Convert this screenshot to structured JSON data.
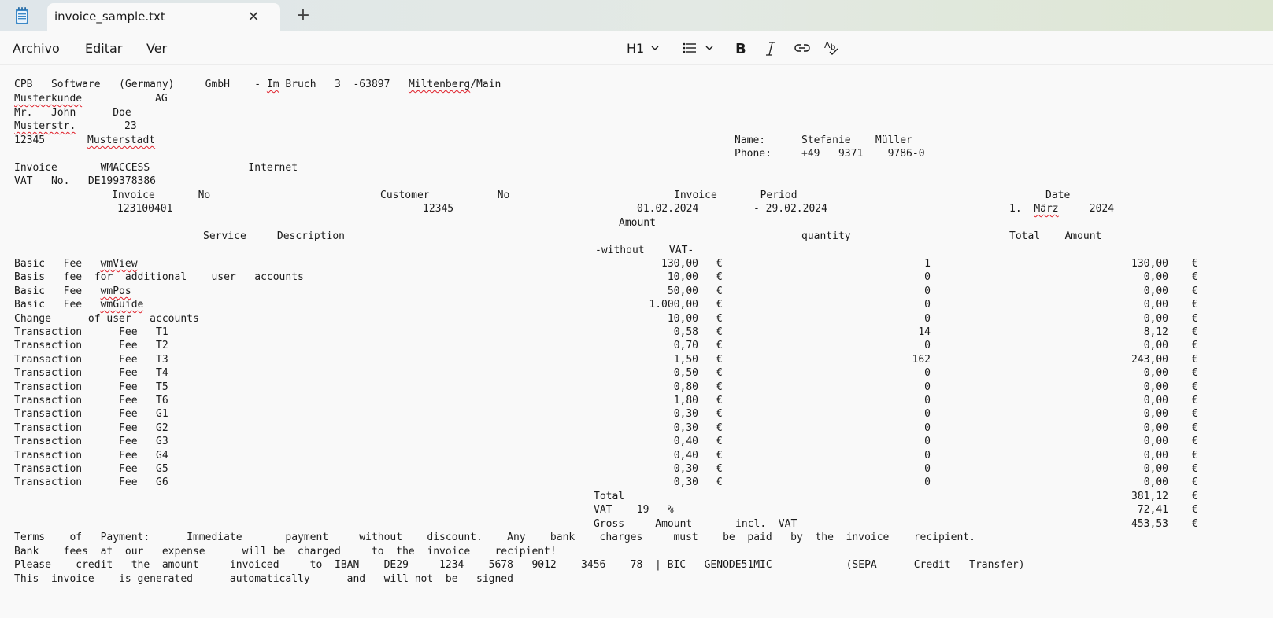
{
  "window": {
    "app_icon": "notepad-icon",
    "tab_title": "invoice_sample.txt",
    "close_icon": "close-icon",
    "new_tab_icon": "plus-icon"
  },
  "menu": {
    "items": [
      "Archivo",
      "Editar",
      "Ver"
    ]
  },
  "toolbar": {
    "heading_label": "H1",
    "heading_icon": "chevron-down-icon",
    "list_icon": "bulleted-list-icon",
    "bold_icon": "bold-icon",
    "italic_icon": "italic-icon",
    "link_icon": "link-icon",
    "spellcheck_icon": "spellcheck-icon"
  },
  "document": {
    "header": {
      "company_a": "CPB   Software   (Germany)     GmbH    - ",
      "company_im": "Im",
      "company_b": " Bruch   3  -63897   ",
      "company_city": "Miltenberg",
      "company_c": "/Main",
      "customer_name": "Musterkunde",
      "customer_ag": "AG",
      "contact": "Mr.   John      Doe",
      "street": "Musterstr.",
      "street_no": "23",
      "zip": "12345",
      "city": "Musterstadt",
      "name_label": "Name:",
      "name_value": "Stefanie    Müller",
      "phone_label": "Phone:",
      "phone_value": "+49   9371    9786-0",
      "invoice_line": "Invoice       WMACCESS                Internet",
      "vat_line": "VAT   No.   DE199378386"
    },
    "invoice_info": {
      "col_invoice_no": "Invoice       No",
      "col_customer_no": "Customer           No",
      "col_period": "Invoice       Period",
      "col_date": "Date",
      "invoice_no": "123100401",
      "customer_no": "12345",
      "period_from": "01.02.2024",
      "period_to": "- 29.02.2024",
      "date_a": "1.  ",
      "date_month": "März",
      "date_b": "     2024"
    },
    "table_header": {
      "amount": "Amount",
      "service": "Service     Description",
      "quantity": "quantity",
      "total_amount": "Total    Amount",
      "without_vat": "-without    VAT-"
    },
    "rows": [
      {
        "desc_a": "Basic   Fee   ",
        "desc_b": "wmView",
        "desc_c": "",
        "amount": "130,00",
        "cur": "€",
        "qty": "1",
        "total": "130,00",
        "cur2": "€"
      },
      {
        "desc_a": "Basis   fee  for  additional    user   accounts",
        "desc_b": "",
        "desc_c": "",
        "amount": "10,00",
        "cur": "€",
        "qty": "0",
        "total": "0,00",
        "cur2": "€"
      },
      {
        "desc_a": "Basic   Fee   ",
        "desc_b": "wmPos",
        "desc_c": "",
        "amount": "50,00",
        "cur": "€",
        "qty": "0",
        "total": "0,00",
        "cur2": "€"
      },
      {
        "desc_a": "Basic   Fee   ",
        "desc_b": "wmGuide",
        "desc_c": "",
        "amount": "1.000,00",
        "cur": "€",
        "qty": "0",
        "total": "0,00",
        "cur2": "€"
      },
      {
        "desc_a": "Change      of user   accounts",
        "desc_b": "",
        "desc_c": "",
        "amount": "10,00",
        "cur": "€",
        "qty": "0",
        "total": "0,00",
        "cur2": "€"
      },
      {
        "desc_a": "Transaction      Fee   T1",
        "desc_b": "",
        "desc_c": "",
        "amount": "0,58",
        "cur": "€",
        "qty": "14",
        "total": "8,12",
        "cur2": "€"
      },
      {
        "desc_a": "Transaction      Fee   T2",
        "desc_b": "",
        "desc_c": "",
        "amount": "0,70",
        "cur": "€",
        "qty": "0",
        "total": "0,00",
        "cur2": "€"
      },
      {
        "desc_a": "Transaction      Fee   T3",
        "desc_b": "",
        "desc_c": "",
        "amount": "1,50",
        "cur": "€",
        "qty": "162",
        "total": "243,00",
        "cur2": "€"
      },
      {
        "desc_a": "Transaction      Fee   T4",
        "desc_b": "",
        "desc_c": "",
        "amount": "0,50",
        "cur": "€",
        "qty": "0",
        "total": "0,00",
        "cur2": "€"
      },
      {
        "desc_a": "Transaction      Fee   T5",
        "desc_b": "",
        "desc_c": "",
        "amount": "0,80",
        "cur": "€",
        "qty": "0",
        "total": "0,00",
        "cur2": "€"
      },
      {
        "desc_a": "Transaction      Fee   T6",
        "desc_b": "",
        "desc_c": "",
        "amount": "1,80",
        "cur": "€",
        "qty": "0",
        "total": "0,00",
        "cur2": "€"
      },
      {
        "desc_a": "Transaction      Fee   G1",
        "desc_b": "",
        "desc_c": "",
        "amount": "0,30",
        "cur": "€",
        "qty": "0",
        "total": "0,00",
        "cur2": "€"
      },
      {
        "desc_a": "Transaction      Fee   G2",
        "desc_b": "",
        "desc_c": "",
        "amount": "0,30",
        "cur": "€",
        "qty": "0",
        "total": "0,00",
        "cur2": "€"
      },
      {
        "desc_a": "Transaction      Fee   G3",
        "desc_b": "",
        "desc_c": "",
        "amount": "0,40",
        "cur": "€",
        "qty": "0",
        "total": "0,00",
        "cur2": "€"
      },
      {
        "desc_a": "Transaction      Fee   G4",
        "desc_b": "",
        "desc_c": "",
        "amount": "0,40",
        "cur": "€",
        "qty": "0",
        "total": "0,00",
        "cur2": "€"
      },
      {
        "desc_a": "Transaction      Fee   G5",
        "desc_b": "",
        "desc_c": "",
        "amount": "0,30",
        "cur": "€",
        "qty": "0",
        "total": "0,00",
        "cur2": "€"
      },
      {
        "desc_a": "Transaction      Fee   G6",
        "desc_b": "",
        "desc_c": "",
        "amount": "0,30",
        "cur": "€",
        "qty": "0",
        "total": "0,00",
        "cur2": "€"
      }
    ],
    "totals": {
      "total_label": "Total",
      "total_value": "381,12",
      "vat_label": "VAT    19   %",
      "vat_value": "72,41",
      "gross_label": "Gross     Amount       incl.  VAT",
      "gross_value": "453,53",
      "currency": "€"
    },
    "footer": [
      "Terms    of   Payment:      Immediate       payment     without    discount.    Any    bank    charges     must    be  paid   by  the  invoice    recipient.",
      "Bank    fees  at  our   expense      will be  charged     to  the  invoice    recipient!",
      "Please    credit   the  amount     invoiced     to  IBAN    DE29     1234    5678   9012    3456    78  | BIC   GENODE51MIC            (SEPA      Credit   Transfer)",
      "This  invoice    is generated      automatically      and   will not  be   signed"
    ]
  }
}
